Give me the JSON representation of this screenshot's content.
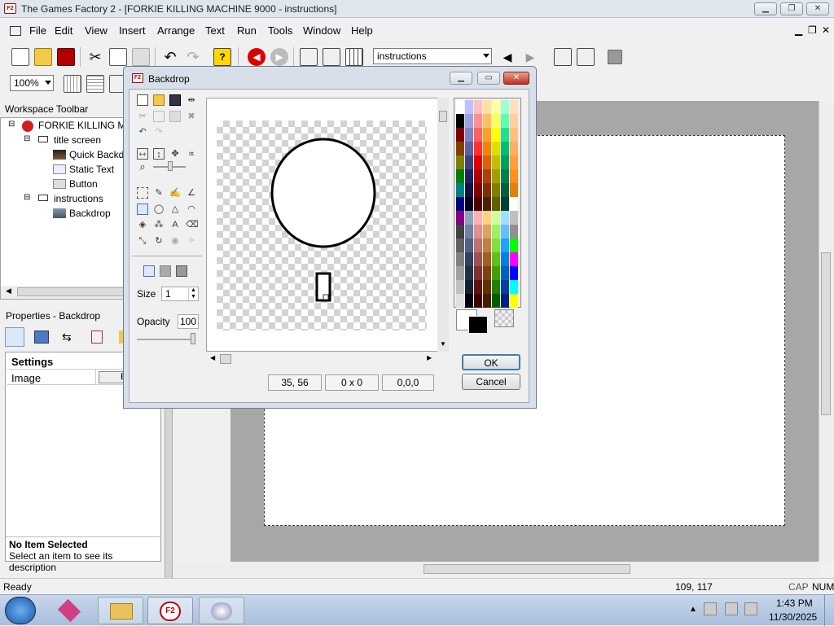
{
  "window": {
    "title": "The Games Factory 2 - [FORKIE KILLING MACHINE 9000 - instructions]",
    "app_icon_text": "F2"
  },
  "menu": [
    "File",
    "Edit",
    "View",
    "Insert",
    "Arrange",
    "Text",
    "Run",
    "Tools",
    "Window",
    "Help"
  ],
  "toolbar": {
    "frame_combo": "instructions",
    "zoom_combo": "100%"
  },
  "workspace": {
    "header": "Workspace Toolbar",
    "tree": [
      {
        "label": "FORKIE KILLING MA",
        "level": 0,
        "icon": "game-icon"
      },
      {
        "label": "title screen",
        "level": 1,
        "icon": "frame-icon"
      },
      {
        "label": "Quick Backd",
        "level": 2,
        "icon": "quick-backdrop-icon"
      },
      {
        "label": "Static Text",
        "level": 2,
        "icon": "static-text-icon"
      },
      {
        "label": "Button",
        "level": 2,
        "icon": "button-object-icon"
      },
      {
        "label": "instructions",
        "level": 1,
        "icon": "frame-icon"
      },
      {
        "label": "Backdrop",
        "level": 2,
        "icon": "backdrop-icon"
      }
    ]
  },
  "properties": {
    "header": "Properties - Backdrop",
    "section": "Settings",
    "row_label": "Image",
    "row_button": "E",
    "info_title": "No Item Selected",
    "info_desc": "Select an item to see its description"
  },
  "dialog": {
    "title": "Backdrop",
    "size_label": "Size",
    "size_value": "1",
    "opacity_label": "Opacity",
    "opacity_value": "100",
    "coords": "35, 56",
    "selection": "0 x 0",
    "hotspot": "0,0,0",
    "ok": "OK",
    "cancel": "Cancel",
    "colors": {
      "foreground": "#000000",
      "background": "#ffffff"
    }
  },
  "status": {
    "text": "Ready",
    "coords": "109, 117",
    "cap": "CAP",
    "num": "NUM"
  },
  "clock": {
    "time": "1:43 PM",
    "date": "11/30/2025"
  }
}
